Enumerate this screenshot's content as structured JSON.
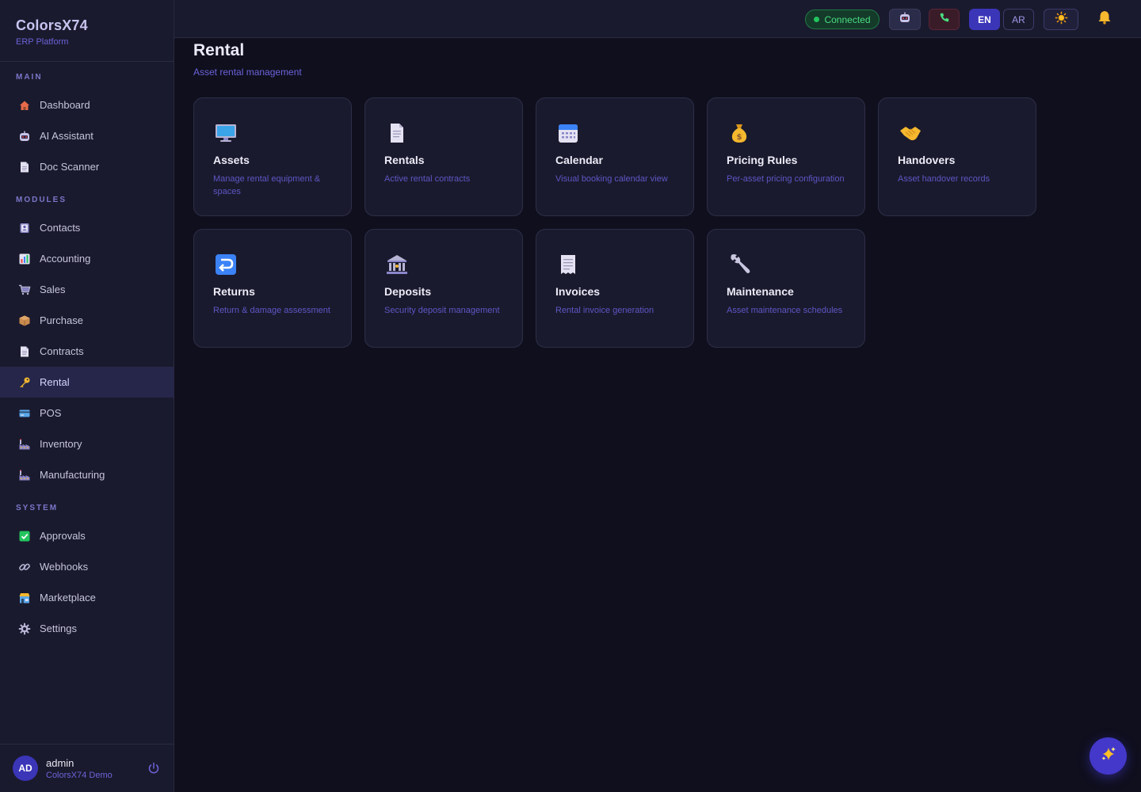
{
  "brand": {
    "title": "ColorsX74",
    "subtitle": "ERP Platform"
  },
  "sidebar": {
    "sections": [
      {
        "label": "MAIN",
        "items": [
          {
            "label": "Dashboard",
            "icon": "house-icon"
          },
          {
            "label": "AI Assistant",
            "icon": "robot-icon"
          },
          {
            "label": "Doc Scanner",
            "icon": "document-icon"
          }
        ]
      },
      {
        "label": "MODULES",
        "items": [
          {
            "label": "Contacts",
            "icon": "contacts-icon"
          },
          {
            "label": "Accounting",
            "icon": "chart-icon"
          },
          {
            "label": "Sales",
            "icon": "cart-icon"
          },
          {
            "label": "Purchase",
            "icon": "package-icon"
          },
          {
            "label": "Contracts",
            "icon": "document-icon"
          },
          {
            "label": "Rental",
            "icon": "key-icon",
            "active": true
          },
          {
            "label": "POS",
            "icon": "credit-card-icon"
          },
          {
            "label": "Inventory",
            "icon": "factory-icon"
          },
          {
            "label": "Manufacturing",
            "icon": "factory-icon"
          }
        ]
      },
      {
        "label": "SYSTEM",
        "items": [
          {
            "label": "Approvals",
            "icon": "check-icon"
          },
          {
            "label": "Webhooks",
            "icon": "link-icon"
          },
          {
            "label": "Marketplace",
            "icon": "shop-icon"
          },
          {
            "label": "Settings",
            "icon": "gear-icon"
          }
        ]
      }
    ]
  },
  "user": {
    "initials": "AD",
    "name": "admin",
    "org": "ColorsX74 Demo"
  },
  "topbar": {
    "status": "Connected",
    "lang_en": "EN",
    "lang_ar": "AR"
  },
  "page": {
    "title": "Rental",
    "subtitle": "Asset rental management"
  },
  "cards": [
    {
      "title": "Assets",
      "desc": "Manage rental equipment & spaces",
      "icon": "monitor-icon"
    },
    {
      "title": "Rentals",
      "desc": "Active rental contracts",
      "icon": "document-icon"
    },
    {
      "title": "Calendar",
      "desc": "Visual booking calendar view",
      "icon": "calendar-icon"
    },
    {
      "title": "Pricing Rules",
      "desc": "Per-asset pricing configuration",
      "icon": "money-bag-icon"
    },
    {
      "title": "Handovers",
      "desc": "Asset handover records",
      "icon": "handshake-icon"
    },
    {
      "title": "Returns",
      "desc": "Return & damage assessment",
      "icon": "return-arrow-icon"
    },
    {
      "title": "Deposits",
      "desc": "Security deposit management",
      "icon": "bank-icon"
    },
    {
      "title": "Invoices",
      "desc": "Rental invoice generation",
      "icon": "receipt-icon"
    },
    {
      "title": "Maintenance",
      "desc": "Asset maintenance schedules",
      "icon": "wrench-icon"
    }
  ],
  "colors": {
    "accent": "#3b35b8",
    "sidebar_bg": "#1a1a2e",
    "page_bg": "#0f0f1e",
    "success": "#22c55e"
  }
}
